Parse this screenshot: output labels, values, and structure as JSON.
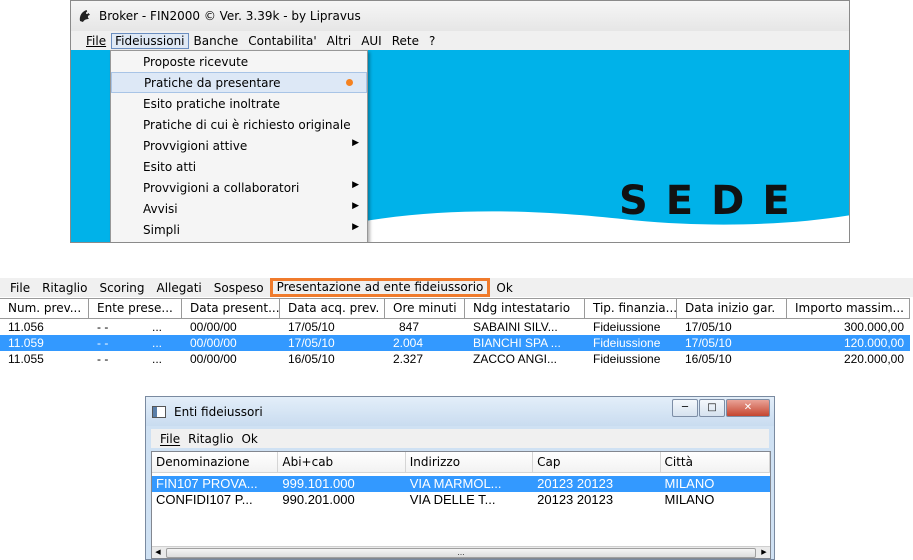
{
  "window1": {
    "title": "Broker - FIN2000 © Ver.  3.39k - by Lipravus",
    "menu": [
      "File",
      "Fideiussioni",
      "Banche",
      "Contabilita'",
      "Altri",
      "AUI",
      "Rete",
      "?"
    ],
    "active_menu": "Fideiussioni",
    "dropdown": [
      {
        "label": "Proposte ricevute"
      },
      {
        "label": "Pratiche da presentare"
      },
      {
        "label": "Esito pratiche inoltrate"
      },
      {
        "label": "Pratiche di cui è richiesto originale"
      },
      {
        "label": "Provvigioni attive"
      },
      {
        "label": "Esito atti"
      },
      {
        "label": "Provvigioni a collaboratori"
      },
      {
        "label": "Avvisi"
      },
      {
        "label": "Simpli"
      }
    ],
    "sede": "SEDE",
    "client_color": "#00b2e9"
  },
  "toolbar2": {
    "items": [
      "File",
      "Ritaglio",
      "Scoring",
      "Allegati",
      "Sospeso",
      "Presentazione ad ente fideiussorio",
      "Ok"
    ]
  },
  "grid": {
    "columns": [
      "Num. prev...",
      "Ente prese...",
      "Data present...",
      "Data acq. prev.",
      "Ore minuti",
      "Ndg intestatario",
      "Tip. finanzia...",
      "Data inizio gar.",
      "Importo massim..."
    ],
    "rows": [
      [
        "11.056",
        "- -",
        "...",
        "00/00/00",
        "17/05/10",
        "847",
        "SABAINI SILV...",
        "Fideiussione",
        "17/05/10",
        "300.000,00"
      ],
      [
        "11.059",
        "- -",
        "...",
        "00/00/00",
        "17/05/10",
        "2.004",
        "BIANCHI SPA ...",
        "Fideiussione",
        "17/05/10",
        "120.000,00"
      ],
      [
        "11.055",
        "- -",
        "...",
        "00/00/00",
        "16/05/10",
        "2.327",
        "ZACCO ANGI...",
        "Fideiussione",
        "16/05/10",
        "220.000,00"
      ]
    ],
    "selected_color": "#3399ff"
  },
  "dialog": {
    "title": "Enti fideiussori",
    "menu": [
      "File",
      "Ritaglio",
      "Ok"
    ],
    "columns": [
      "Denominazione",
      "Abi+cab",
      "Indirizzo",
      "Cap",
      "Città"
    ],
    "rows": [
      [
        "FIN107 PROVA...",
        "999.101.000",
        "VIA MARMOL...",
        "20123 20123",
        "MILANO"
      ],
      [
        "CONFIDI107 P...",
        "990.201.000",
        "VIA DELLE T...",
        "20123 20123",
        "MILANO"
      ]
    ],
    "scroll_grip": "…"
  },
  "highlight_color": "#f07b2c"
}
